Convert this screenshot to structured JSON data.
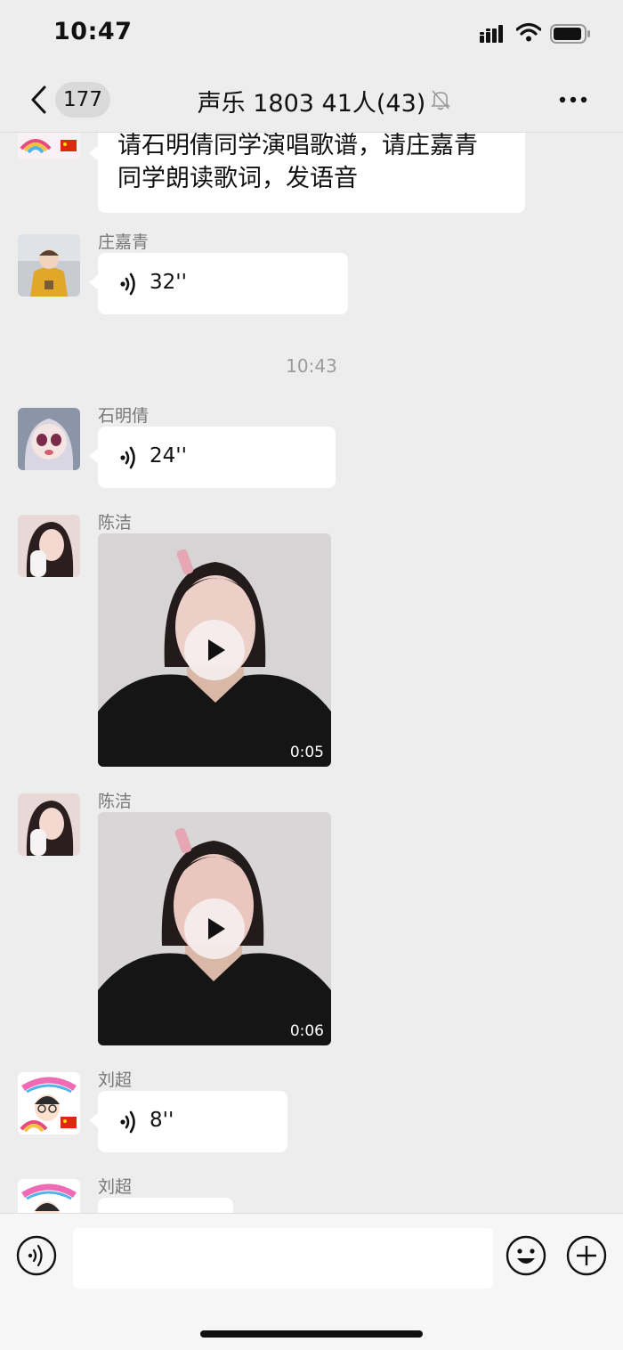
{
  "status_bar": {
    "time": "10:47"
  },
  "nav": {
    "back_count": "177",
    "title": "声乐 1803 41人(43)"
  },
  "messages": {
    "m0": {
      "text_line1": "请石明倩同学演唱歌谱，请庄嘉青",
      "text_line2": "同学朗读歌词，发语音"
    },
    "m1": {
      "sender": "庄嘉青",
      "duration": "32''"
    },
    "time_divider": "10:43",
    "m2": {
      "sender": "石明倩",
      "duration": "24''"
    },
    "m3": {
      "sender": "陈洁",
      "video_duration": "0:05"
    },
    "m4": {
      "sender": "陈洁",
      "video_duration": "0:06"
    },
    "m5": {
      "sender": "刘超",
      "duration": "8''"
    },
    "m6": {
      "sender": "刘超"
    }
  },
  "input_bar": {
    "placeholder": ""
  },
  "icons": [
    "signal-icon",
    "wifi-icon",
    "battery-icon",
    "back-chevron-icon",
    "mute-bell-icon",
    "more-dots-icon",
    "voice-wave-icon",
    "play-icon",
    "voice-toggle-icon",
    "emoji-icon",
    "plus-icon"
  ],
  "colors": {
    "background": "#ededed",
    "bubble": "#ffffff",
    "meta_text": "#777777",
    "time_text": "#9c9c9c"
  }
}
